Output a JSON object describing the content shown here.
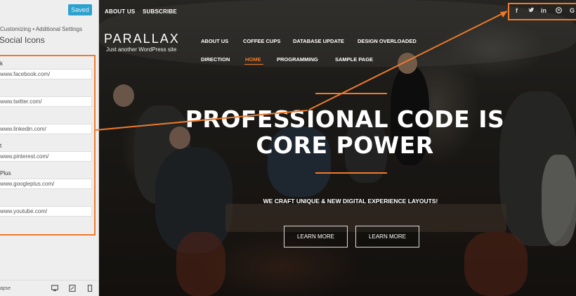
{
  "customizer": {
    "saved_label": "Saved",
    "breadcrumb": "Customizing • Additional Settings",
    "section_title": "Social Icons",
    "fields": [
      {
        "label": "k",
        "value": "www.facebook.com/"
      },
      {
        "label": "",
        "value": "www.twitter.com/"
      },
      {
        "label": "",
        "value": "www.linkedin.com/"
      },
      {
        "label": "t",
        "value": "www.pinterest.com/"
      },
      {
        "label": "Plus",
        "value": "www.googleplus.com/"
      },
      {
        "label": "",
        "value": "www.youtube.com/"
      }
    ],
    "footer": {
      "collapse_label": "apse",
      "devices": [
        "desktop-icon",
        "tablet-icon",
        "mobile-icon"
      ]
    }
  },
  "preview": {
    "topbar": {
      "links": [
        "ABOUT US",
        "SUBSCRIBE"
      ]
    },
    "social_icons": [
      {
        "name": "facebook-icon",
        "glyph": "f"
      },
      {
        "name": "twitter-icon",
        "glyph": "•"
      },
      {
        "name": "linkedin-icon",
        "glyph": "in"
      },
      {
        "name": "pinterest-icon",
        "glyph": "⊙"
      },
      {
        "name": "googleplus-icon",
        "glyph": "G"
      }
    ],
    "site_title": "PARALLAX",
    "tagline": "Just another WordPress site",
    "menu_row1": [
      "ABOUT US",
      "COFFEE CUPS",
      "DATABASE UPDATE",
      "DESIGN OVERLOADED"
    ],
    "menu_row2": [
      "DIRECTION",
      "HOME",
      "PROGRAMMING",
      "SAMPLE PAGE"
    ],
    "active_menu": "HOME",
    "headline": "PROFESSIONAL CODE IS CORE POWER",
    "subheadline": "WE CRAFT UNIQUE & NEW DIGITAL EXPERIENCE LAYOUTS!",
    "buttons": [
      "LEARN MORE",
      "LEARN MORE"
    ],
    "accent_color": "#ee7b2b",
    "panel_button_color": "#2ea2cc"
  }
}
